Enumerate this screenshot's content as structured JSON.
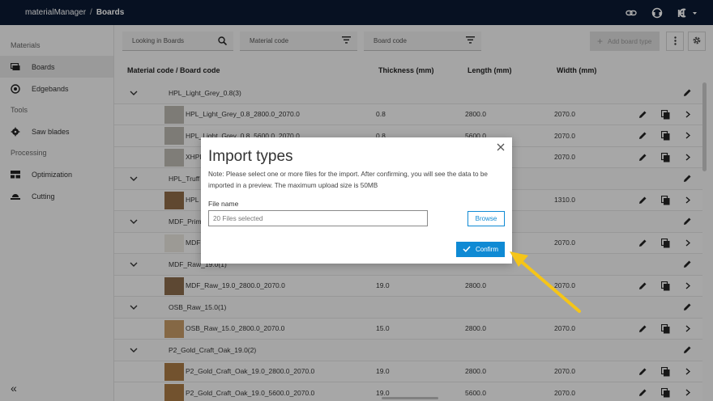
{
  "app": {
    "name": "materialManager",
    "separator": "/",
    "current_page": "Boards"
  },
  "topbar": {
    "icons": [
      "link-icon",
      "support-icon",
      "user-menu-icon"
    ]
  },
  "sidebar": {
    "sections": [
      {
        "title": "Materials",
        "items": [
          {
            "label": "Boards",
            "icon": "boards-icon",
            "active": true
          },
          {
            "label": "Edgebands",
            "icon": "edgebands-icon"
          }
        ]
      },
      {
        "title": "Tools",
        "items": [
          {
            "label": "Saw blades",
            "icon": "saw-blade-icon"
          }
        ]
      },
      {
        "title": "Processing",
        "items": [
          {
            "label": "Optimization",
            "icon": "optimization-icon"
          },
          {
            "label": "Cutting",
            "icon": "cutting-icon"
          }
        ]
      }
    ],
    "collapse_label": "«"
  },
  "filters": {
    "search_placeholder": "Looking in Boards",
    "material_code_placeholder": "Material code",
    "board_code_placeholder": "Board code",
    "add_button_label": "Add board type"
  },
  "table": {
    "headers": {
      "code": "Material code / Board code",
      "thickness": "Thickness (mm)",
      "length": "Length (mm)",
      "width": "Width (mm)"
    },
    "rows": [
      {
        "type": "group",
        "label": "HPL_Light_Grey_0.8(3)"
      },
      {
        "type": "item",
        "name": "HPL_Light_Grey_0.8_2800.0_2070.0",
        "thickness": "0.8",
        "length": "2800.0",
        "width": "2070.0",
        "swatch": "#b9b5ae"
      },
      {
        "type": "item",
        "name": "HPL_Light_Grey_0.8_5600.0_2070.0",
        "thickness": "0.8",
        "length": "5600.0",
        "width": "2070.0",
        "swatch": "#b9b5ae"
      },
      {
        "type": "item",
        "name": "XHPL",
        "thickness": "",
        "length": "",
        "width": "2070.0",
        "swatch": "#bcb8b1"
      },
      {
        "type": "group",
        "label": "HPL_Truff"
      },
      {
        "type": "item",
        "name": "HPL",
        "thickness": "",
        "length": "",
        "width": "1310.0",
        "swatch": "#8e6a48"
      },
      {
        "type": "group",
        "label": "MDF_Prim"
      },
      {
        "type": "item",
        "name": "MDF",
        "thickness": "",
        "length": "",
        "width": "2070.0",
        "swatch": "#e6e3dc"
      },
      {
        "type": "group",
        "label": "MDF_Raw_19.0(1)"
      },
      {
        "type": "item",
        "name": "MDF_Raw_19.0_2800.0_2070.0",
        "thickness": "19.0",
        "length": "2800.0",
        "width": "2070.0",
        "swatch": "#8a6a4c"
      },
      {
        "type": "group",
        "label": "OSB_Raw_15.0(1)"
      },
      {
        "type": "item",
        "name": "OSB_Raw_15.0_2800.0_2070.0",
        "thickness": "15.0",
        "length": "2800.0",
        "width": "2070.0",
        "swatch": "#c49a66"
      },
      {
        "type": "group",
        "label": "P2_Gold_Craft_Oak_19.0(2)"
      },
      {
        "type": "item",
        "name": "P2_Gold_Craft_Oak_19.0_2800.0_2070.0",
        "thickness": "19.0",
        "length": "2800.0",
        "width": "2070.0",
        "swatch": "#a87a45"
      },
      {
        "type": "item",
        "name": "P2_Gold_Craft_Oak_19.0_5600.0_2070.0",
        "thickness": "19.0",
        "length": "5600.0",
        "width": "2070.0",
        "swatch": "#a87a45"
      }
    ]
  },
  "modal": {
    "title": "Import types",
    "note": "Note: Please select one or more files for the import. After confirming, you will see the data to be imported in a preview. The maximum upload size is 50MB",
    "file_label": "File name",
    "file_value": "20 Files selected",
    "browse_label": "Browse",
    "confirm_label": "Confirm"
  },
  "colors": {
    "topbar": "#0b1a33",
    "accent": "#0f8ad4",
    "pointer_arrow": "#f5c518"
  }
}
